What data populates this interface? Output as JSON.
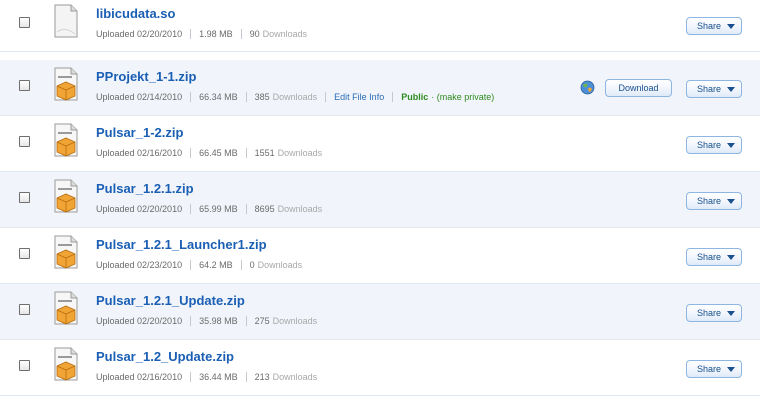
{
  "buttons": {
    "share_label": "Share",
    "download_label": "Download"
  },
  "colors": {
    "link": "#1a5fb4",
    "public": "#2e8b1e",
    "row_alt": "#f1f5fb"
  },
  "files": [
    {
      "name": "libicudata.so",
      "uploaded": "Uploaded 02/20/2010",
      "size": "1.98 MB",
      "downloads": "90",
      "downloads_label": "Downloads",
      "icon": "generic-file-icon"
    },
    {
      "name": "PProjekt_1-1.zip",
      "uploaded": "Uploaded 02/14/2010",
      "size": "66.34 MB",
      "downloads": "385",
      "downloads_label": "Downloads",
      "icon": "zip-archive-icon",
      "edit_label": "Edit File Info",
      "public_label": "Public",
      "make_private_label": "· (make private)"
    },
    {
      "name": "Pulsar_1-2.zip",
      "uploaded": "Uploaded 02/16/2010",
      "size": "66.45 MB",
      "downloads": "1551",
      "downloads_label": "Downloads",
      "icon": "zip-archive-icon"
    },
    {
      "name": "Pulsar_1.2.1.zip",
      "uploaded": "Uploaded 02/20/2010",
      "size": "65.99 MB",
      "downloads": "8695",
      "downloads_label": "Downloads",
      "icon": "zip-archive-icon"
    },
    {
      "name": "Pulsar_1.2.1_Launcher1.zip",
      "uploaded": "Uploaded 02/23/2010",
      "size": "64.2 MB",
      "downloads": "0",
      "downloads_label": "Downloads",
      "icon": "zip-archive-icon"
    },
    {
      "name": "Pulsar_1.2.1_Update.zip",
      "uploaded": "Uploaded 02/20/2010",
      "size": "35.98 MB",
      "downloads": "275",
      "downloads_label": "Downloads",
      "icon": "zip-archive-icon"
    },
    {
      "name": "Pulsar_1.2_Update.zip",
      "uploaded": "Uploaded 02/16/2010",
      "size": "36.44 MB",
      "downloads": "213",
      "downloads_label": "Downloads",
      "icon": "zip-archive-icon"
    }
  ]
}
